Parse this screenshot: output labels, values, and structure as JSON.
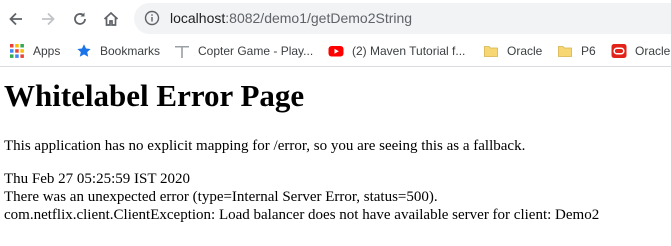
{
  "browser": {
    "address": {
      "host": "localhost",
      "path": ":8082/demo1/getDemo2String"
    },
    "bookmarks": [
      {
        "label": "Apps",
        "icon": "apps-grid-icon"
      },
      {
        "label": "Bookmarks",
        "icon": "star-icon"
      },
      {
        "label": "Copter Game - Play...",
        "icon": "copter-icon"
      },
      {
        "label": "(2) Maven Tutorial f...",
        "icon": "youtube-icon"
      },
      {
        "label": "Oracle",
        "icon": "folder-icon"
      },
      {
        "label": "P6",
        "icon": "folder-icon"
      },
      {
        "label": "Oracle",
        "icon": "oracle-icon"
      }
    ]
  },
  "page": {
    "title": "Whitelabel Error Page",
    "description": "This application has no explicit mapping for /error, so you are seeing this as a fallback.",
    "timestamp": "Thu Feb 27 05:25:59 IST 2020",
    "error_line": "There was an unexpected error (type=Internal Server Error, status=500).",
    "exception_line": "com.netflix.client.ClientException: Load balancer does not have available server for client: Demo2"
  },
  "colors": {
    "accent_blue": "#1a73e8",
    "youtube_red": "#ff0000",
    "folder_yellow": "#f7d774",
    "oracle_red": "#e2231a"
  }
}
